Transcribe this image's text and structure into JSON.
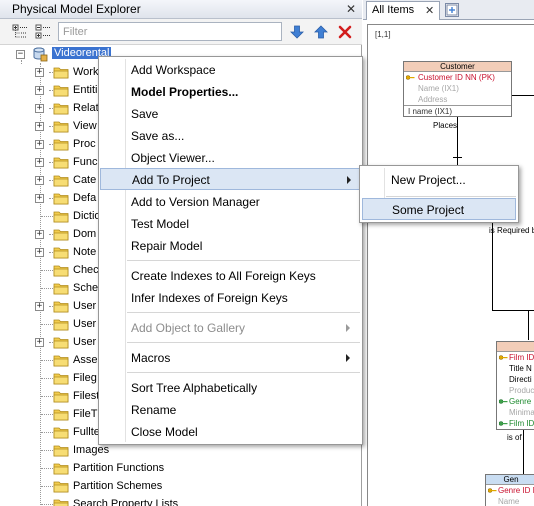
{
  "explorer": {
    "title": "Physical Model Explorer",
    "close_glyph": "✕",
    "filter_placeholder": "Filter",
    "toolbar": {
      "expand_icon": "expand-all-icon",
      "collapse_icon": "collapse-all-icon",
      "down_icon": "arrow-down-icon",
      "up_icon": "arrow-up-icon",
      "delete_icon": "delete-icon"
    },
    "tree": {
      "root": "Videorental",
      "items": [
        {
          "label": "Work",
          "expandable": true
        },
        {
          "label": "Entiti",
          "expandable": true
        },
        {
          "label": "Relat",
          "expandable": true
        },
        {
          "label": "View",
          "expandable": true
        },
        {
          "label": "Proc",
          "expandable": true
        },
        {
          "label": "Func",
          "expandable": true
        },
        {
          "label": "Cate",
          "expandable": true
        },
        {
          "label": "Defa",
          "expandable": true
        },
        {
          "label": "Dictio",
          "expandable": false
        },
        {
          "label": "Dom",
          "expandable": true
        },
        {
          "label": "Note",
          "expandable": true
        },
        {
          "label": "Chec",
          "expandable": false
        },
        {
          "label": "Sche",
          "expandable": false
        },
        {
          "label": "User",
          "expandable": true
        },
        {
          "label": "User",
          "expandable": false
        },
        {
          "label": "User",
          "expandable": true
        },
        {
          "label": "Asse",
          "expandable": false
        },
        {
          "label": "Fileg",
          "expandable": false
        },
        {
          "label": "Filest",
          "expandable": false
        },
        {
          "label": "FileT",
          "expandable": false
        },
        {
          "label": "Fullte",
          "expandable": false
        },
        {
          "label": "Images",
          "expandable": false
        },
        {
          "label": "Partition Functions",
          "expandable": false
        },
        {
          "label": "Partition Schemes",
          "expandable": false
        },
        {
          "label": "Search Property Lists",
          "expandable": false
        }
      ]
    }
  },
  "diagram": {
    "tab_label": "All Items",
    "tab_close": "✕",
    "zoom": "[1,1]",
    "entities": {
      "customer": {
        "title": "Customer",
        "rows": [
          "Customer ID NN  (PK)",
          "Name  (IX1)",
          "Address"
        ],
        "index": "I  name (IX1)"
      },
      "film": {
        "rows": [
          "Film ID",
          "Title N",
          "Directi",
          "Produc",
          "Genre I",
          "Minima",
          "Film ID"
        ]
      },
      "genre": {
        "title": "Gen",
        "rows": [
          "Genre ID N",
          "Name"
        ]
      }
    },
    "relations": {
      "places": "Places",
      "is_required_by": "is Required b",
      "is_of": "is of"
    }
  },
  "context_menu": {
    "items": [
      {
        "label": "Add Workspace"
      },
      {
        "label": "Model Properties..."
      },
      {
        "label": "Save"
      },
      {
        "label": "Save as..."
      },
      {
        "label": "Object Viewer..."
      },
      {
        "label": "Add To Project"
      },
      {
        "label": "Add to Version Manager"
      },
      {
        "label": "Test Model"
      },
      {
        "label": "Repair Model"
      },
      {
        "label": "Create Indexes to All Foreign Keys"
      },
      {
        "label": "Infer Indexes of Foreign Keys"
      },
      {
        "label": "Add Object to Gallery"
      },
      {
        "label": "Macros"
      },
      {
        "label": "Sort Tree Alphabetically"
      },
      {
        "label": "Rename"
      },
      {
        "label": "Close Model"
      }
    ],
    "submenu": {
      "items": [
        {
          "label": "New Project..."
        },
        {
          "label": "Some Project"
        }
      ]
    }
  },
  "colors": {
    "selection": "#3b73d0",
    "menu_highlight": "#dbe6f4",
    "pk_red": "#c8102e",
    "entity_header": "#f2cdb8",
    "entity_header_blue": "#c9ddf2"
  }
}
